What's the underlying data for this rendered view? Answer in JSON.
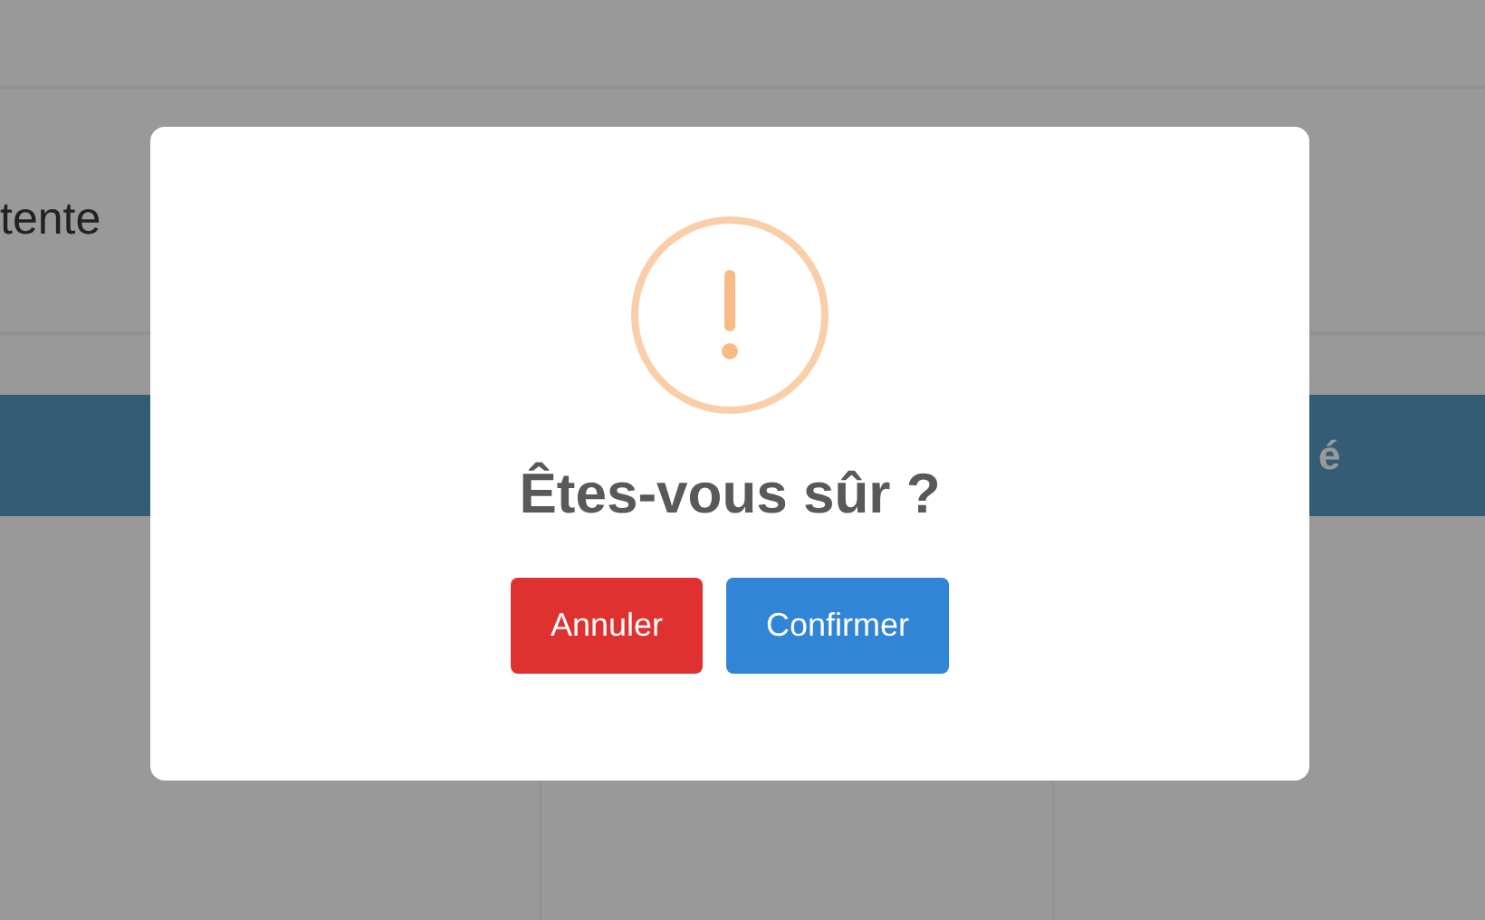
{
  "page": {
    "heading_fragment": "tente",
    "table": {
      "column_3": "é"
    }
  },
  "dialog": {
    "icon": {
      "kind": "warning"
    },
    "title": "Êtes-vous sûr ?",
    "buttons": [
      {
        "label": "Annuler",
        "kind": "cancel"
      },
      {
        "label": "Confirmer",
        "kind": "confirm"
      }
    ]
  }
}
